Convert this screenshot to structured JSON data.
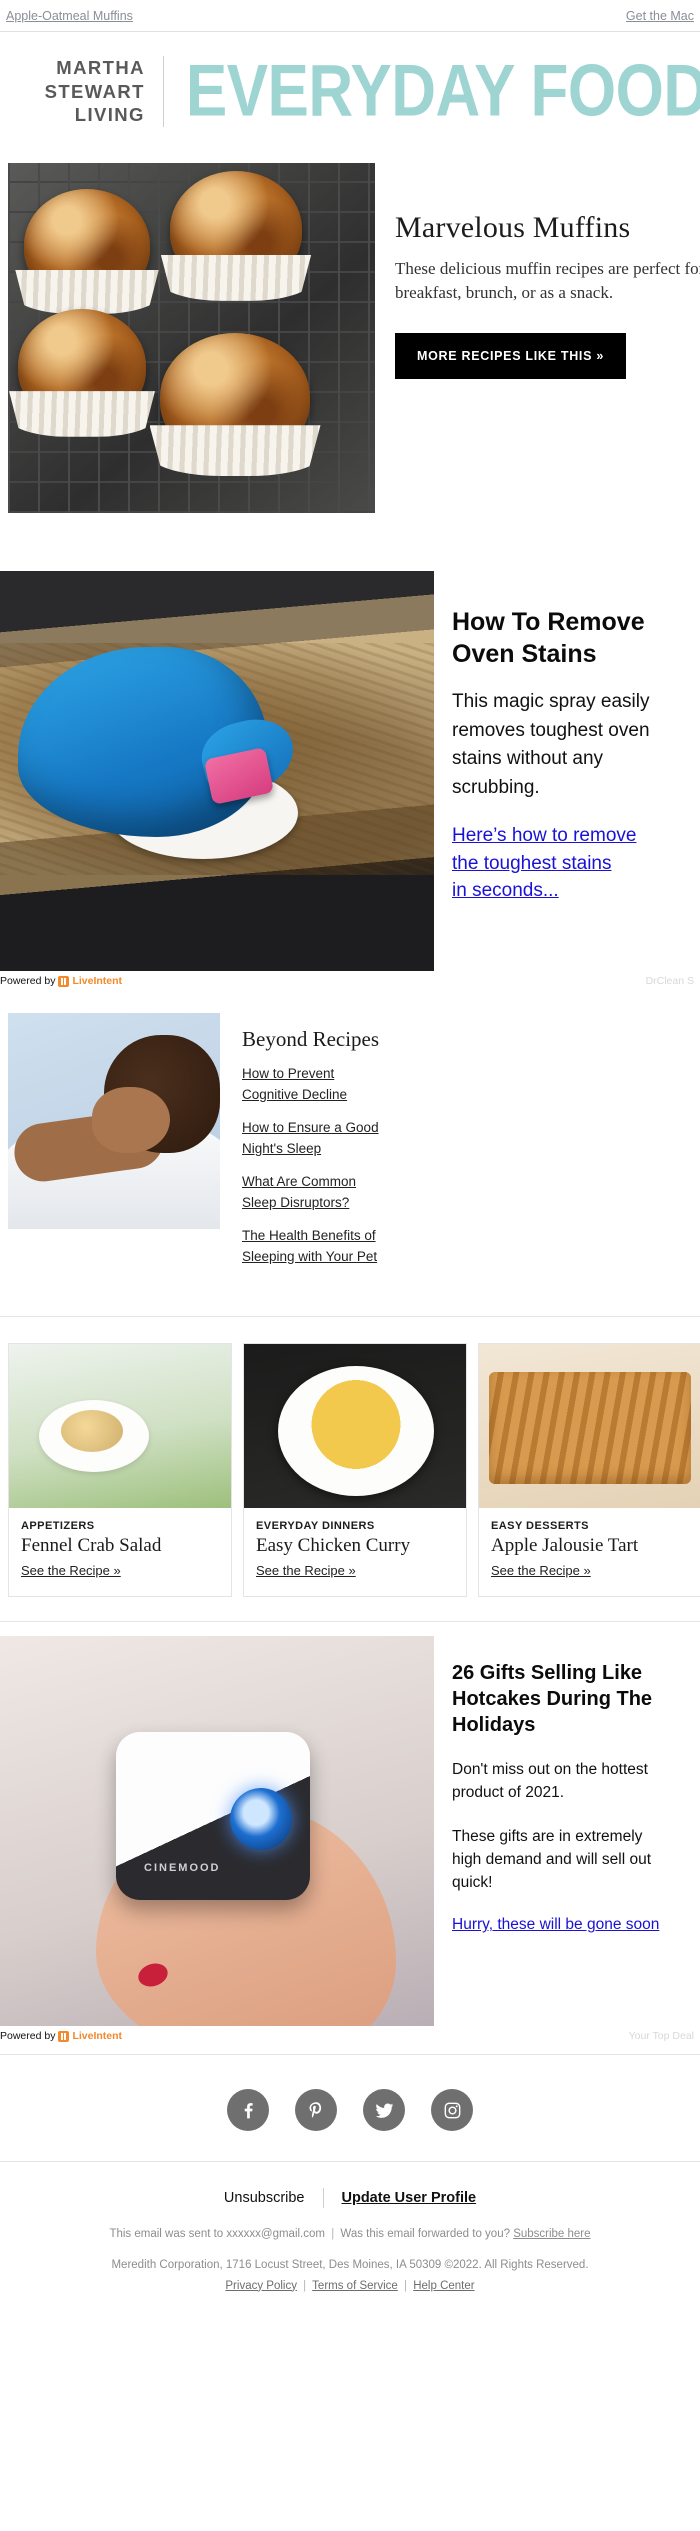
{
  "preheader": {
    "left_link": "Apple-Oatmeal Muffins",
    "right_link": "Get the Mac"
  },
  "masthead": {
    "brand_line1": "MARTHA",
    "brand_line2": "STEWART",
    "brand_line3": "LIVING",
    "title": "EVERYDAY FOOD",
    "title_color": "#9ed4d2"
  },
  "hero": {
    "title": "Marvelous Muffins",
    "desc_line1": "These delicious muffin recipes are perfect for",
    "desc_line2": "breakfast, brunch, or as a snack.",
    "cta": "MORE RECIPES LIKE THIS »"
  },
  "ad1": {
    "headline_line1": "How To Remove",
    "headline_line2": "Oven Stains",
    "body_line1": "This magic spray easily",
    "body_line2": "removes toughest oven",
    "body_line3": "stains without any",
    "body_line4": "scrubbing.",
    "link_line1": "Here’s how to remove",
    "link_line2": "the toughest stains",
    "link_line3": "in seconds...",
    "powered_by": "Powered by",
    "network": "LiveIntent",
    "advertiser": "DrClean S",
    "link_color": "#1a11d6",
    "network_color": "#f2892b"
  },
  "beyond": {
    "title": "Beyond Recipes",
    "links": [
      "How to Prevent Cognitive Decline",
      "How to Ensure a Good Night's Sleep",
      "What Are Common Sleep Disruptors?",
      "The Health Benefits of Sleeping with Your Pet"
    ]
  },
  "cards": [
    {
      "kicker": "APPETIZERS",
      "title": "Fennel Crab Salad",
      "link": "See the Recipe »"
    },
    {
      "kicker": "EVERYDAY DINNERS",
      "title": "Easy Chicken Curry",
      "link": "See the Recipe »"
    },
    {
      "kicker": "EASY DESSERTS",
      "title": "Apple Jalousie Tart",
      "link": "See the Recipe »"
    }
  ],
  "ad2": {
    "headline_line1": "26 Gifts Selling Like",
    "headline_line2": "Hotcakes During The",
    "headline_line3": "Holidays",
    "body1_line1": "Don't miss out on the hottest",
    "body1_line2": "product of 2021.",
    "body2_line1": "These gifts are in extremely",
    "body2_line2": "high demand and will sell out",
    "body2_line3": "quick!",
    "link": "Hurry, these will be gone soon",
    "product_brand": "CINEMOOD",
    "powered_by": "Powered by",
    "network": "LiveIntent",
    "advertiser": "Your Top Deal"
  },
  "social": [
    {
      "name": "facebook",
      "label": "Facebook"
    },
    {
      "name": "pinterest",
      "label": "Pinterest"
    },
    {
      "name": "twitter",
      "label": "Twitter"
    },
    {
      "name": "instagram",
      "label": "Instagram"
    }
  ],
  "footer": {
    "unsubscribe": "Unsubscribe",
    "update_profile": "Update User Profile",
    "sent_to": "This email was sent to xxxxxx@gmail.com",
    "divider1": "|",
    "forwarded": "Was this email forwarded to you?",
    "subscribe_here": "Subscribe here",
    "company": "Meredith Corporation, 1716 Locust Street, Des Moines, IA 50309 ©2022. All Rights Reserved.",
    "privacy_policy": "Privacy Policy",
    "terms": "Terms of Service",
    "help": "Help Center",
    "divider2": "|",
    "divider3": "|"
  }
}
